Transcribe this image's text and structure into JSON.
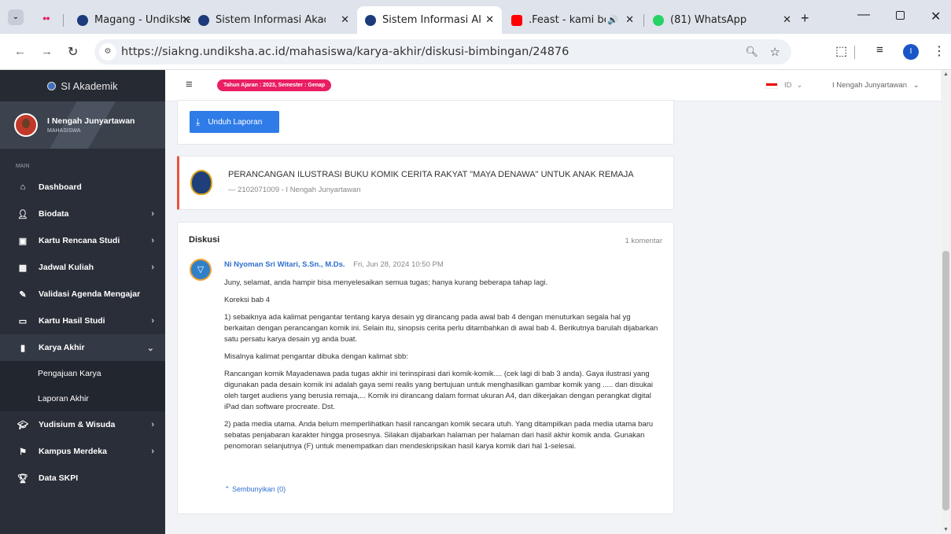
{
  "browser": {
    "tabs": [
      {
        "label": "Magang - Undiksha",
        "active": false
      },
      {
        "label": "Sistem Informasi Akade",
        "active": false
      },
      {
        "label": "Sistem Informasi Akade",
        "active": true
      },
      {
        "label": ".Feast - kami belum",
        "active": false
      },
      {
        "label": "(81) WhatsApp",
        "active": false
      }
    ],
    "url": "https://siakng.undiksha.ac.id/mahasiswa/karya-akhir/diskusi-bimbingan/24876"
  },
  "sidebar": {
    "brand": "SI Akademik",
    "user_name": "I Nengah Junyartawan",
    "user_role": "MAHASISWA",
    "section": "MAIN",
    "items": [
      {
        "label": "Dashboard",
        "icon": "home-icon",
        "chevron": false
      },
      {
        "label": "Biodata",
        "icon": "user-icon",
        "chevron": true
      },
      {
        "label": "Kartu Rencana Studi",
        "icon": "card-icon",
        "chevron": true
      },
      {
        "label": "Jadwal Kuliah",
        "icon": "calendar-icon",
        "chevron": true
      },
      {
        "label": "Validasi Agenda Mengajar",
        "icon": "pencil-icon",
        "chevron": false
      },
      {
        "label": "Kartu Hasil Studi",
        "icon": "creditcard-icon",
        "chevron": true
      },
      {
        "label": "Karya Akhir",
        "icon": "book-icon",
        "chevron": true
      },
      {
        "label": "Yudisium & Wisuda",
        "icon": "graduation-icon",
        "chevron": true
      },
      {
        "label": "Kampus Merdeka",
        "icon": "flag-icon",
        "chevron": true
      },
      {
        "label": "Data SKPI",
        "icon": "trophy-icon",
        "chevron": false
      }
    ],
    "submenu": [
      "Pengajuan Karya",
      "Laporan Akhir"
    ]
  },
  "topbar": {
    "year_badge": "Tahun Ajaran : 2023, Semester : Genap",
    "lang": "ID",
    "user": "I Nengah Junyartawan"
  },
  "main": {
    "download_button": "Unduh Laporan",
    "thesis_title": "PERANCANGAN ILUSTRASI BUKU KOMIK CERITA RAKYAT \"MAYA DENAWA\" UNTUK ANAK REMAJA",
    "thesis_meta": "— 2102071009 - I Nengah Junyartawan",
    "discussion_title": "Diskusi",
    "comment_count": "1 komentar",
    "comment": {
      "author": "Ni Nyoman Sri Witari, S.Sn., M.Ds.",
      "date": "Fri, Jun 28, 2024 10:50 PM",
      "paragraphs": [
        "Juny, selamat, anda hampir bisa  menyelesaikan semua tugas; hanya kurang beberapa tahap lagi.",
        "Koreksi bab 4",
        "1) sebaiknya ada kalimat pengantar tentang karya desain yg dirancang pada awal bab 4 dengan menuturkan segala hal yg berkaitan dengan perancangan komik ini. Selain itu, sinopsis cerita perlu ditambahkan di awal bab 4. Berikutnya barulah dijabarkan satu persatu karya desain yg anda buat.",
        "Misalnya kalimat pengantar dibuka dengan kalimat sbb:",
        "Rancangan komik Mayadenawa pada tugas akhir ini terinspirasi dari komik-komik.... (cek lagi di bab 3 anda). Gaya ilustrasi yang digunakan pada desain komik ini adalah gaya semi realis yang bertujuan untuk menghasilkan gambar komik yang .....  dan disukai oleh target audiens yang berusia remaja,... Komik ini dirancang dalam format ukuran A4, dan dikerjakan dengan perangkat digital iPad dan software procreate. Dst.",
        "2) pada media utama. Anda belum memperlihatkan hasil rancangan komik secara utuh. Yang ditampilkan pada media utama baru sebatas penjabaran karakter hingga prosesnya. Silakan dijabarkan halaman per halaman dari hasil akhir komik anda. Gunakan penomoran selanjutnya (F) untuk menempatkan dan mendeskripsikan hasil karya komik dari hal 1-selesai."
      ],
      "hide_link": "Sembunyikan (0)"
    }
  }
}
